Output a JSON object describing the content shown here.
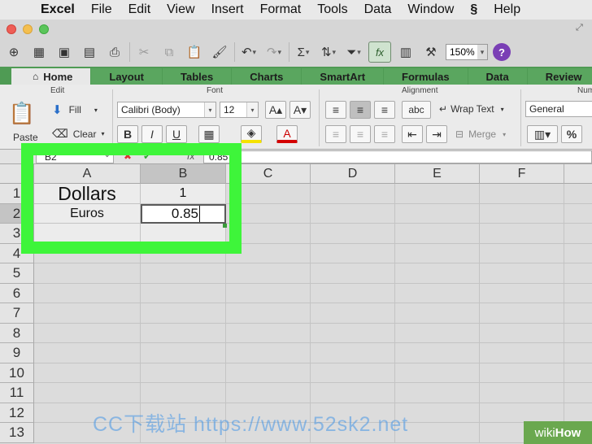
{
  "menubar": {
    "app": "Excel",
    "items": [
      "File",
      "Edit",
      "View",
      "Insert",
      "Format",
      "Tools",
      "Data",
      "Window",
      "Help"
    ]
  },
  "toolbar": {
    "zoom": "150%"
  },
  "ribbon_tabs": [
    "Home",
    "Layout",
    "Tables",
    "Charts",
    "SmartArt",
    "Formulas",
    "Data",
    "Review"
  ],
  "ribbon": {
    "groups": {
      "edit": "Edit",
      "font": "Font",
      "alignment": "Alignment",
      "number": "Num"
    },
    "paste_label": "Paste",
    "fill_label": "Fill",
    "clear_label": "Clear",
    "font_name": "Calibri (Body)",
    "font_size": "12",
    "wrap_text_label": "Wrap Text",
    "merge_label": "Merge",
    "number_format": "General",
    "bold": "B",
    "italic": "I",
    "underline": "U",
    "abc": "abc",
    "percent": "%"
  },
  "formula_bar": {
    "name_box": "B2",
    "content": "0.85"
  },
  "columns": [
    "A",
    "B",
    "C",
    "D",
    "E",
    "F"
  ],
  "rows": [
    "1",
    "2",
    "3",
    "4",
    "5",
    "6",
    "7",
    "8",
    "9",
    "10",
    "11",
    "12",
    "13"
  ],
  "cells": {
    "A1": "Dollars",
    "B1": "1",
    "A2": "Euros",
    "B2": "0.85"
  },
  "watermark": "CC下载站 https://www.52sk2.net",
  "badge": {
    "part1": "wiki",
    "part2": "How"
  },
  "colors": {
    "highlight": "#3ef53a",
    "ribbon_green": "#4f9b54"
  }
}
